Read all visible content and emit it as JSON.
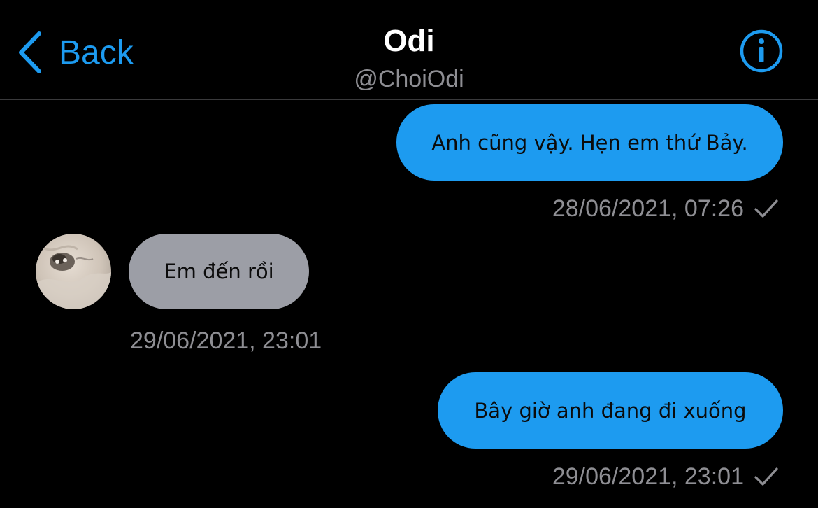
{
  "header": {
    "back_label": "Back",
    "title": "Odi",
    "handle": "@ChoiOdi",
    "info_icon": "info-circle-icon"
  },
  "colors": {
    "accent": "#1d9bf0",
    "background": "#000000",
    "incoming_bubble": "#9c9ea6",
    "meta_text": "#8e8e93"
  },
  "messages": [
    {
      "direction": "outgoing",
      "text": "Anh cũng vậy. Hẹn em thứ Bảy.",
      "timestamp": "28/06/2021, 07:26",
      "status_icon": "checkmark-icon"
    },
    {
      "direction": "incoming",
      "text": "Em đến rồi",
      "timestamp": "29/06/2021, 23:01",
      "avatar": "avatar"
    },
    {
      "direction": "outgoing",
      "text": "Bây giờ anh đang đi xuống",
      "timestamp": "29/06/2021, 23:01",
      "status_icon": "checkmark-icon"
    }
  ]
}
